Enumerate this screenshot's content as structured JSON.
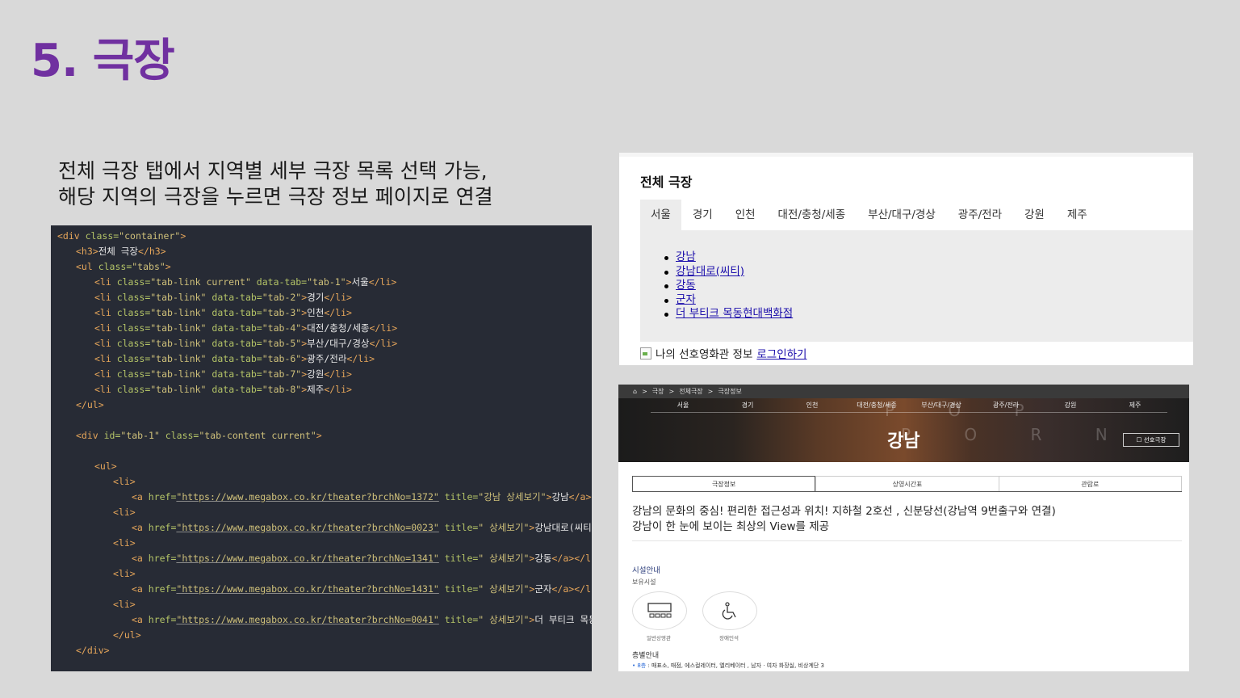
{
  "slide": {
    "title": "5. 극장",
    "desc_line1": "전체 극장 탭에서 지역별  세부 극장 목록 선택 가능,",
    "desc_line2": "해당 지역의 극장을 누르면 극장 정보 페이지로 연결"
  },
  "code_lines": [
    "<div class=\"container\">",
    "<h3>전체 극장</h3>",
    "<ul class=\"tabs\">",
    "<li class=\"tab-link current\" data-tab=\"tab-1\">서울</li>",
    "<li class=\"tab-link\" data-tab=\"tab-2\">경기</li>",
    "<li class=\"tab-link\" data-tab=\"tab-3\">인천</li>",
    "<li class=\"tab-link\" data-tab=\"tab-4\">대전/충청/세종</li>",
    "<li class=\"tab-link\" data-tab=\"tab-5\">부산/대구/경상</li>",
    "<li class=\"tab-link\" data-tab=\"tab-6\">광주/전라</li>",
    "<li class=\"tab-link\" data-tab=\"tab-7\">강원</li>",
    "<li class=\"tab-link\" data-tab=\"tab-8\">제주</li>",
    "</ul>",
    "<div id=\"tab-1\" class=\"tab-content current\">",
    "<ul>",
    "<li>",
    "<a href=\"https://www.megabox.co.kr/theater?brchNo=1372\" title=\"강남 상세보기\">강남</a></li>",
    "<li>",
    "<a href=\"https://www.megabox.co.kr/theater?brchNo=0023\" title=\" 상세보기\">강남대로(씨티)</a></li>",
    "<li>",
    "<a href=\"https://www.megabox.co.kr/theater?brchNo=1341\" title=\" 상세보기\">강동</a></li>",
    "<li>",
    "<a href=\"https://www.megabox.co.kr/theater?brchNo=1431\" title=\" 상세보기\">군자</a></li>",
    "<li>",
    "<a href=\"https://www.megabox.co.kr/theater?brchNo=0041\" title=\" 상세보기\">더 부티크 목동현대백화점</a>",
    "</ul>",
    "</div>"
  ],
  "panel1": {
    "title": "전체 극장",
    "tabs": [
      "서울",
      "경기",
      "인천",
      "대전/충청/세종",
      "부산/대구/경상",
      "광주/전라",
      "강원",
      "제주"
    ],
    "theaters": [
      "강남",
      "강남대로(씨티)",
      "강동",
      "군자",
      "더 부티크 목동현대백화점"
    ],
    "footer_text": "나의 선호영화관 정보",
    "login_link": "로그인하기"
  },
  "panel2": {
    "breadcrumb": [
      "⌂",
      ">",
      "극장",
      ">",
      "전체극장",
      ">",
      "극장정보"
    ],
    "tabs": [
      "서울",
      "경기",
      "인천",
      "대전/충청/세종",
      "부산/대구/경상",
      "광주/전라",
      "강원",
      "제주"
    ],
    "deco_top": "P O P",
    "deco_bottom": "P O R N",
    "theater_name": "강남",
    "fav_button": "선호극장",
    "subtabs": [
      "극장정보",
      "상영시간표",
      "관람료"
    ],
    "intro_line1": "강남의 문화의 중심! 편리한 접근성과 위치! 지하철 2호선 , 신분당선(강남역 9번출구와 연결)",
    "intro_line2": "강남이 한 눈에 보이는 최상의 View를 제공",
    "facility_heading": "시설안내",
    "facility_sub": "보유시설",
    "facility_1": "일반상영관",
    "facility_2": "장애인석",
    "floor_heading": "층별안내",
    "floor_label": "• 8층",
    "floor_text": " : 매표소, 매점, 에스컬레이터, 엘리베이터 , 남자 · 여자 화장실, 비상계단 3"
  }
}
